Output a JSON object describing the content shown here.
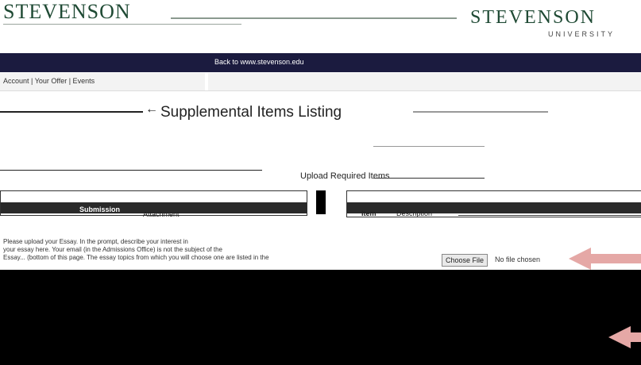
{
  "header": {
    "logo_left": "STEVENSON",
    "logo_right": "STEVENSON",
    "tagline_right": "UNIVERSITY"
  },
  "navbar": {
    "back_link": "Back to www.stevenson.edu"
  },
  "breadcrumb": {
    "left": "Account  |  Your Offer  |  Events",
    "right": ""
  },
  "page": {
    "title": "Supplemental Items Listing",
    "section_label": "Upload Required Items"
  },
  "table": {
    "left_header": "Submission",
    "left_subheader": "Attachment",
    "right_item": "Item",
    "right_description": "Description"
  },
  "upload": {
    "info": "",
    "desc_lines": [
      "Please upload your Essay. In the prompt, describe your interest in",
      "your essay here. Your email (in the Admissions Office) is not the subject of the",
      "Essay... (bottom of this page. The essay topics from which you will choose one are listed in the"
    ],
    "choose_button": "Choose File",
    "no_file": "No file chosen"
  },
  "colors": {
    "brand_green": "#1f4a34",
    "navbar": "#1b1b3f",
    "annotation_arrow": "#e5a8a6"
  }
}
